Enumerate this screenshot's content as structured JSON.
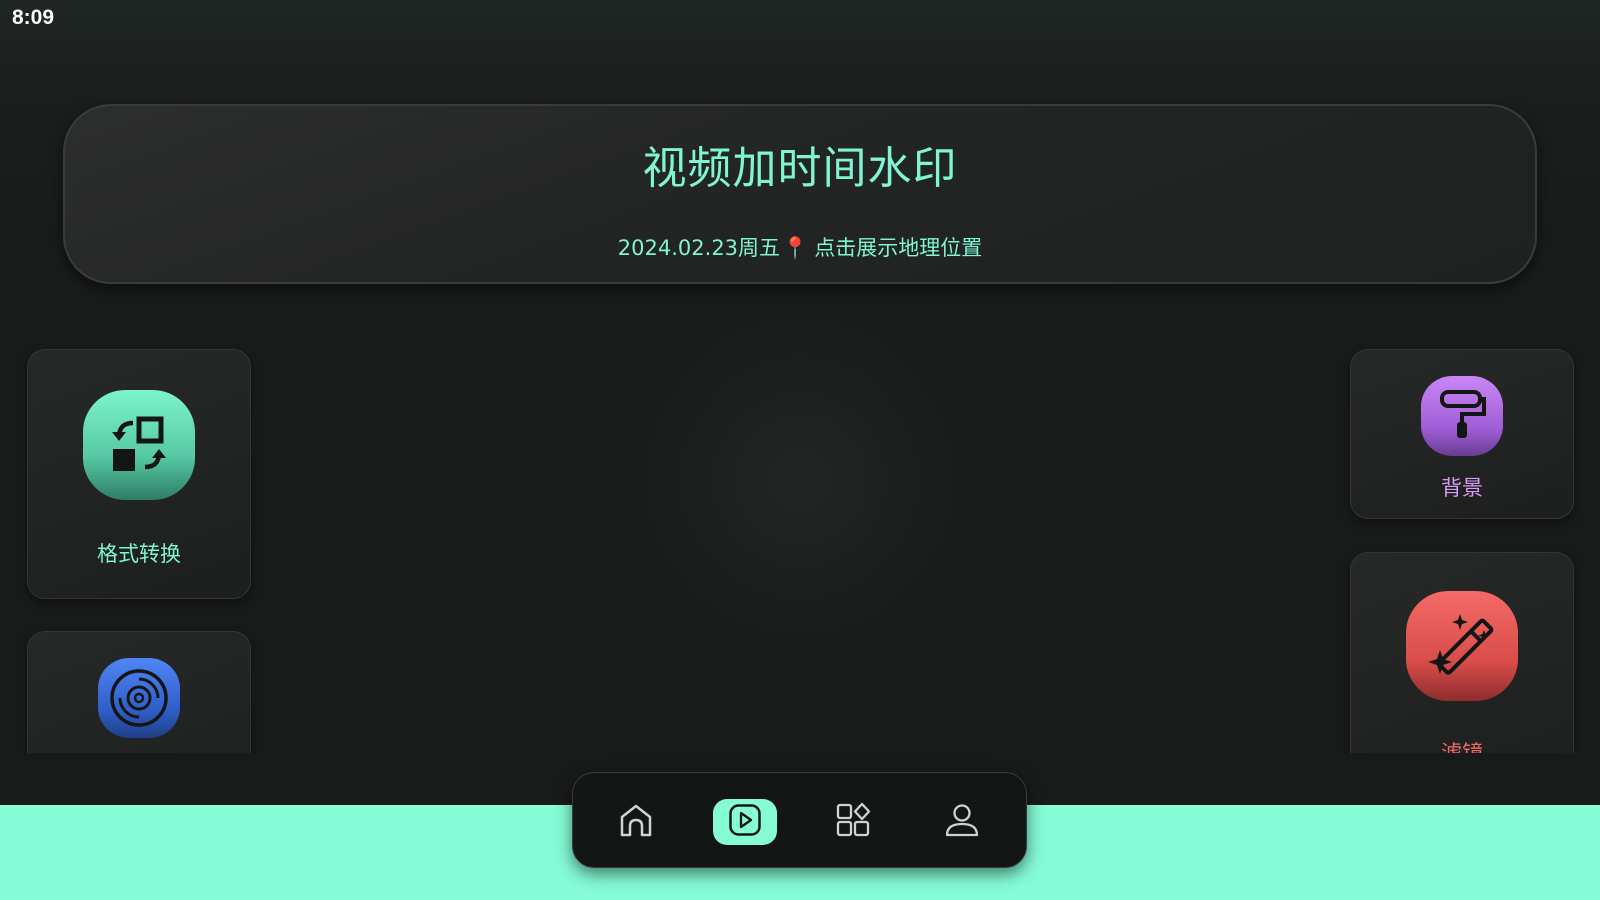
{
  "status_bar": {
    "time": "8:09"
  },
  "header": {
    "title": "视频加时间水印",
    "date": "2024.02.23周五",
    "pin_glyph": "📍",
    "location_prompt": "点击展示地理位置"
  },
  "tiles": {
    "format": {
      "label": "格式转换",
      "icon": "format-convert-icon",
      "color": "#7ff5d2"
    },
    "audio": {
      "label": "",
      "icon": "vinyl-disc-icon",
      "color": "#4f86f5"
    },
    "background": {
      "label": "背景",
      "icon": "paint-roller-icon",
      "color": "#c986f7"
    },
    "filter": {
      "label": "滤镜",
      "icon": "magic-wand-icon",
      "color": "#f26a66"
    }
  },
  "nav": {
    "items": [
      {
        "name": "home",
        "icon": "home-icon",
        "active": false
      },
      {
        "name": "video",
        "icon": "play-icon",
        "active": true
      },
      {
        "name": "apps",
        "icon": "apps-grid-icon",
        "active": false
      },
      {
        "name": "profile",
        "icon": "user-icon",
        "active": false
      }
    ],
    "accent": "#85fbd6"
  },
  "colors": {
    "background": "#191b1a",
    "accent": "#7ff5d2",
    "bottom_band": "#85fbd6"
  }
}
